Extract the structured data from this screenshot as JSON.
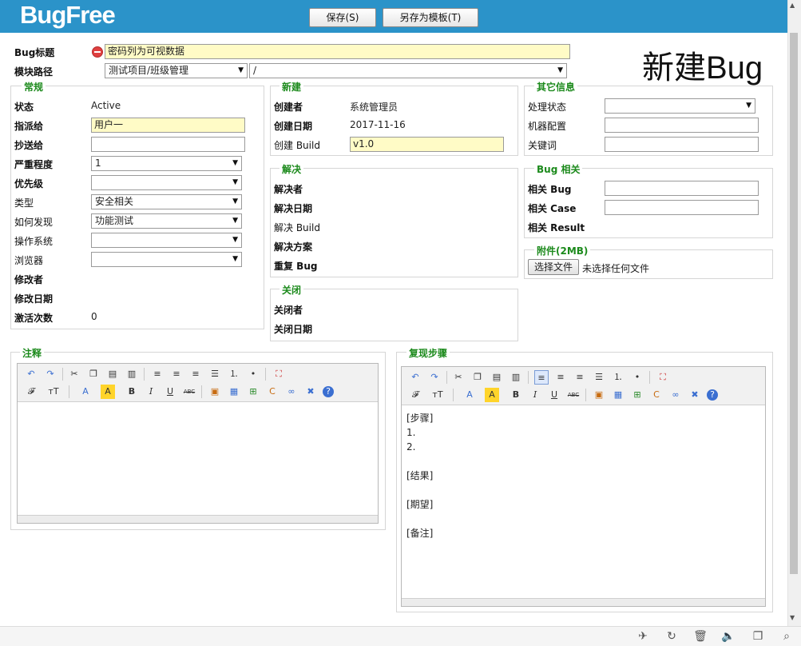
{
  "header": {
    "logo": "BugFree",
    "save_label": "保存(S)",
    "save_template_label": "另存为模板(T)"
  },
  "page_title": "新建Bug",
  "form": {
    "title_label": "Bug标题",
    "title_value": "密码列为可视数据",
    "module_label": "模块路径",
    "project_value": "测试项目/班级管理",
    "module_value": "/"
  },
  "general": {
    "group_title": "常规",
    "status_label": "状态",
    "status_value": "Active",
    "assigned_label": "指派给",
    "assigned_value": "用户一",
    "cc_label": "抄送给",
    "cc_value": "",
    "severity_label": "严重程度",
    "severity_value": "1",
    "priority_label": "优先级",
    "priority_value": "",
    "type_label": "类型",
    "type_value": "安全相关",
    "howfound_label": "如何发现",
    "howfound_value": "功能测试",
    "os_label": "操作系统",
    "os_value": "",
    "browser_label": "浏览器",
    "browser_value": "",
    "modifier_label": "修改者",
    "modified_date_label": "修改日期",
    "reopen_count_label": "激活次数",
    "reopen_count_value": "0"
  },
  "created": {
    "group_title": "新建",
    "creator_label": "创建者",
    "creator_value": "系统管理员",
    "created_date_label": "创建日期",
    "created_date_value": "2017-11-16",
    "build_label": "创建 Build",
    "build_value": "v1.0"
  },
  "resolved": {
    "group_title": "解决",
    "resolver_label": "解决者",
    "resolved_date_label": "解决日期",
    "build_label": "解决 Build",
    "solution_label": "解决方案",
    "duplicate_label": "重复 Bug"
  },
  "closed": {
    "group_title": "关闭",
    "closer_label": "关闭者",
    "closed_date_label": "关闭日期"
  },
  "other": {
    "group_title": "其它信息",
    "process_status_label": "处理状态",
    "process_status_value": "",
    "machine_config_label": "机器配置",
    "machine_config_value": "",
    "keywords_label": "关键词",
    "keywords_value": ""
  },
  "related": {
    "group_title": "Bug 相关",
    "bug_label": "相关 Bug",
    "bug_value": "",
    "case_label": "相关 Case",
    "case_value": "",
    "result_label": "相关 Result"
  },
  "attachment": {
    "group_title": "附件(2MB)",
    "choose_button": "选择文件",
    "no_file_text": "未选择任何文件"
  },
  "notes": {
    "group_title": "注释"
  },
  "repro": {
    "group_title": "复现步骤",
    "line1": "[步骤]",
    "line2": "1.",
    "line3": "2.",
    "line4": "[结果]",
    "line5": "[期望]",
    "line6": "[备注]"
  },
  "icons": {
    "browser_bar": [
      "pin-icon",
      "refresh-icon",
      "trash-icon",
      "audio-icon",
      "window-icon",
      "search-icon"
    ]
  },
  "colors": {
    "header_bg": "#2b93c9",
    "group_title": "#1c8a1c",
    "required_field_bg": "#fffbc6"
  }
}
